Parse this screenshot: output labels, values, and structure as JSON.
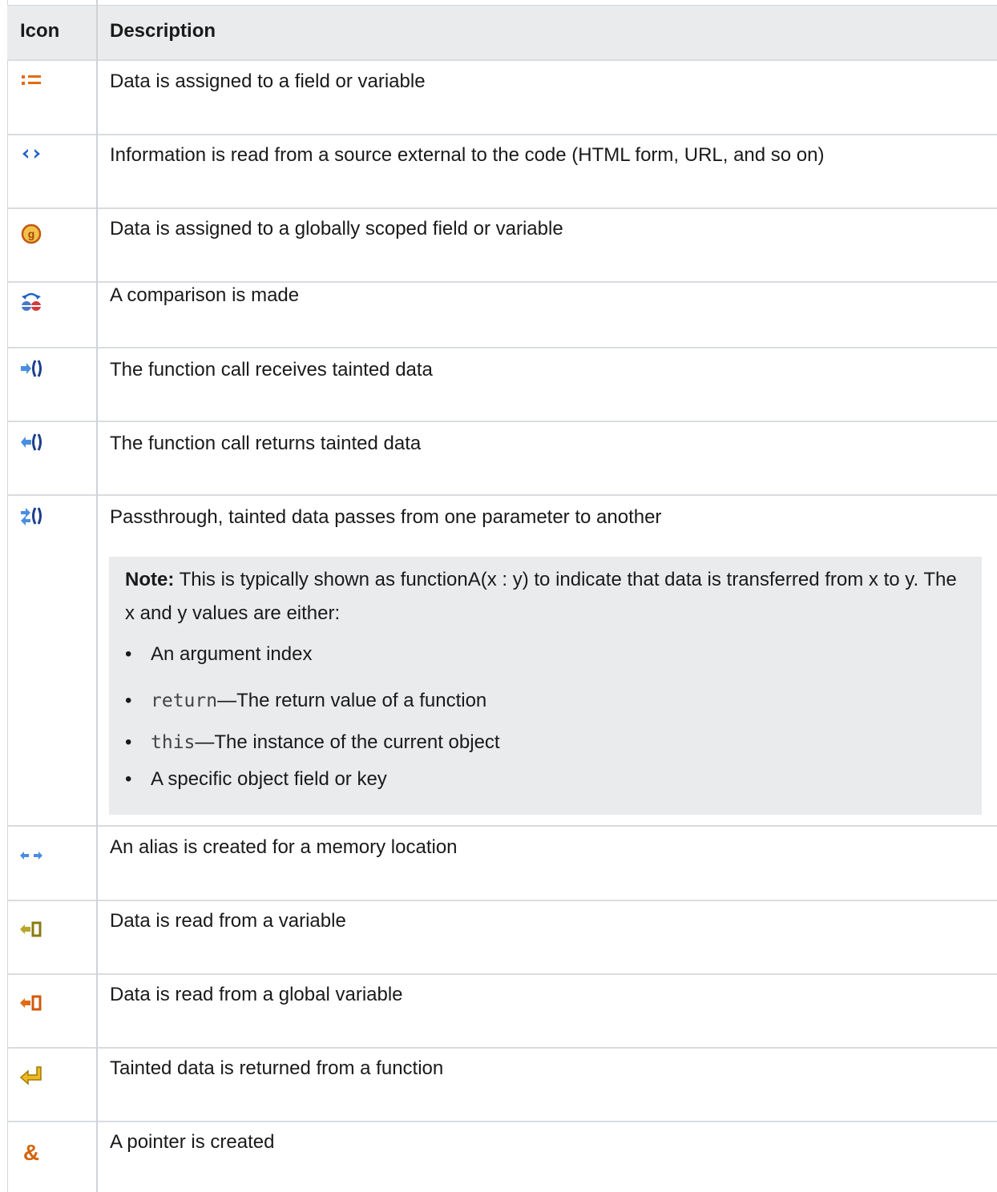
{
  "header": {
    "col_icon": "Icon",
    "col_description": "Description"
  },
  "rows": [
    {
      "icon": "assign-icon",
      "description": "Data is assigned to a field or variable"
    },
    {
      "icon": "external-read-icon",
      "description": "Information is read from a source external to the code (HTML form, URL, and so on)"
    },
    {
      "icon": "global-assign-icon",
      "description": "Data is assigned to a globally scoped field or variable"
    },
    {
      "icon": "comparison-icon",
      "description": "A comparison is made"
    },
    {
      "icon": "call-receives-icon",
      "description": "The function call receives tainted data"
    },
    {
      "icon": "call-returns-icon",
      "description": "The function call returns tainted data"
    },
    {
      "icon": "passthrough-icon",
      "description": "Passthrough, tainted data passes from one parameter to another"
    },
    {
      "icon": "alias-icon",
      "description": "An alias is created for a memory location"
    },
    {
      "icon": "read-variable-icon",
      "description": "Data is read from a variable"
    },
    {
      "icon": "read-global-variable-icon",
      "description": "Data is read from a global variable"
    },
    {
      "icon": "return-icon",
      "description": "Tainted data is returned from a function"
    },
    {
      "icon": "pointer-icon",
      "description": "A pointer is created"
    }
  ],
  "note": {
    "label": "Note:",
    "text": "This is typically shown as functionA(x : y) to indicate that data is transferred from x to y. The x and y values are either:",
    "bullets": [
      {
        "code": "",
        "text": "An argument index"
      },
      {
        "code": "return",
        "text": "—The return value of a function"
      },
      {
        "code": "this",
        "text": "—The instance of the current object"
      },
      {
        "code": "",
        "text": "A specific object field or key"
      }
    ]
  },
  "colors": {
    "header_bg": "#e9ebec",
    "note_bg": "#e9ebec",
    "rule": "#d9dcdf",
    "blue": "#1f63c6",
    "orange": "#e26a12",
    "olive": "#9b8a10"
  }
}
